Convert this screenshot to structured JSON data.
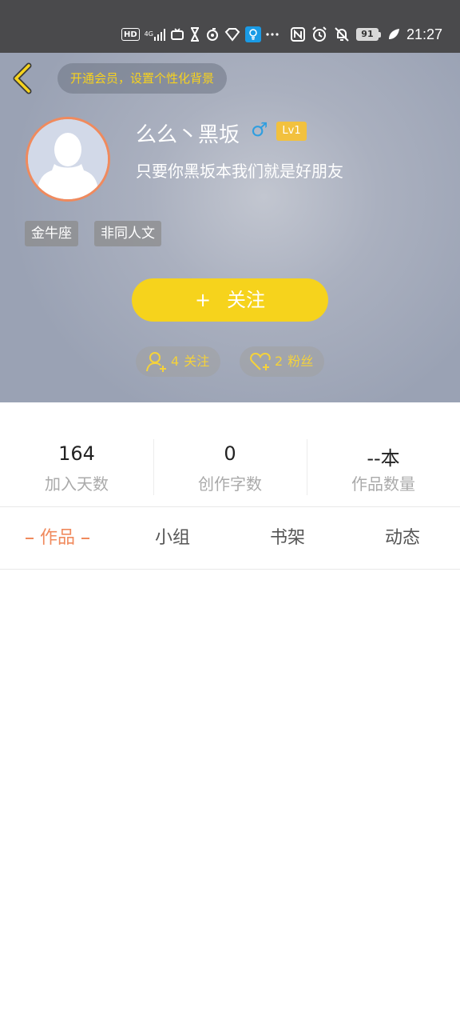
{
  "status_bar": {
    "hd": "HD",
    "network": "4G",
    "battery": "91",
    "time": "21:27",
    "icons": [
      "hd-icon",
      "signal-icon",
      "tv-icon",
      "hourglass-icon",
      "sync-icon",
      "diamond-icon",
      "bulb-app-icon",
      "more-icon",
      "nfc-icon",
      "alarm-icon",
      "mute-icon",
      "battery-icon",
      "leaf-icon"
    ]
  },
  "header": {
    "vip_text": "开通会员，设置个性化背景",
    "username": "么么丶黑坂",
    "gender_symbol": "♂",
    "level": "Lv1",
    "signature": "只要你黑坂本我们就是好朋友",
    "tags": [
      "金牛座",
      "非同人文"
    ],
    "follow_plus": "+",
    "follow_label": "关注",
    "following_count": "4",
    "following_label": "关注",
    "fans_count": "2",
    "fans_label": "粉丝"
  },
  "stats": [
    {
      "value": "164",
      "label": "加入天数"
    },
    {
      "value": "0",
      "label": "创作字数"
    },
    {
      "value": "--本",
      "label": "作品数量"
    }
  ],
  "tabs": [
    "作品",
    "小组",
    "书架",
    "动态"
  ],
  "colors": {
    "accent_yellow": "#f6d31c",
    "accent_orange": "#f08a5d",
    "gender_blue": "#2e9ee0",
    "status_bar_bg": "#4a4a4c"
  }
}
